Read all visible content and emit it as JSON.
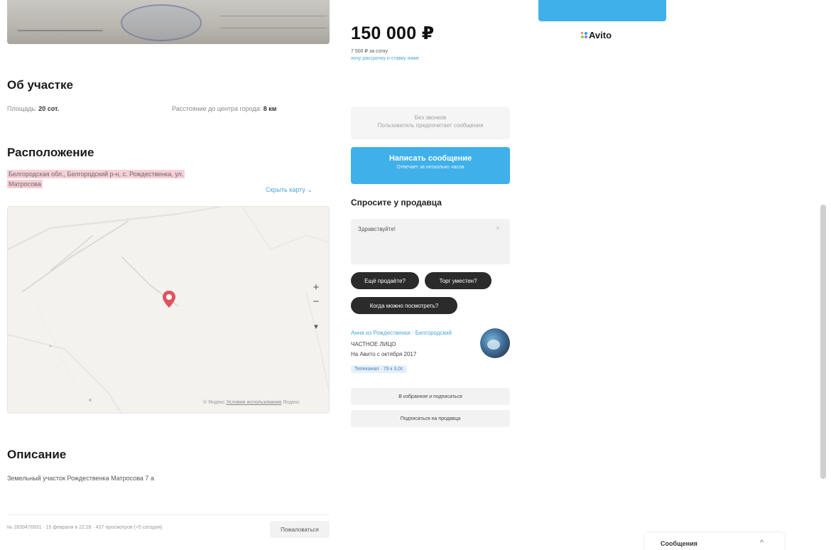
{
  "listing": {
    "price": "150 000 ₽",
    "price_per_unit": "7 500 ₽ за сотку",
    "price_link": "хочу рассрочку и ставку ниже"
  },
  "about": {
    "title": "Об участке",
    "area_label": "Площадь:",
    "area_value": "20 сот.",
    "distance_label": "Расстояние до центра города:",
    "distance_value": "8 км"
  },
  "location": {
    "title": "Расположение",
    "address_line1": "Белгородская обл., Белгородский р-н, с. Рождественка, ул.",
    "address_line2": "Матросова",
    "hide_map": "Скрыть карту"
  },
  "map": {
    "zoom_in": "+",
    "zoom_out": "−",
    "locate": "▾",
    "credit_prefix": "© Яндекс",
    "credit_link": "Условия использования",
    "credit_suffix": "Яндекс"
  },
  "description": {
    "title": "Описание",
    "text": "Земельный участок Рождественка Матросова 7 а"
  },
  "footer": {
    "meta": "№ 2839476931 · 15 февраля в 22:28 · 437 просмотров (+5 сегодня)",
    "complain": "Пожаловаться"
  },
  "contact": {
    "phone_line1": "Без звонков",
    "phone_line2": "Пользователь предпочитает сообщения",
    "write_main": "Написать сообщение",
    "write_sub": "Отвечает за несколько часов"
  },
  "ask": {
    "title": "Спросите у продавца",
    "input_value": "Здравствуйте!",
    "clear": "×",
    "chips": [
      "Ещё продаёте?",
      "Торг уместен?",
      "Когда можно посмотреть?"
    ]
  },
  "seller": {
    "name": "Анна из Рождественки · Белгородский",
    "type": "ЧАСТНОЕ ЛИЦО",
    "since": "На Авито с октября 2017",
    "badge": "Телеканал · 79 к 3,0с"
  },
  "actions": {
    "subscribe": "В избранное и подписаться",
    "share": "Подписаться на продавца"
  },
  "brand": {
    "logo": "Avito"
  },
  "widget": {
    "messages": "Сообщения",
    "chevron": "^"
  },
  "colors": {
    "accent": "#3fb0ea",
    "address_highlight": "#f7cfd8",
    "pin": "#e0525e",
    "chip_bg": "#2b2b2b"
  }
}
